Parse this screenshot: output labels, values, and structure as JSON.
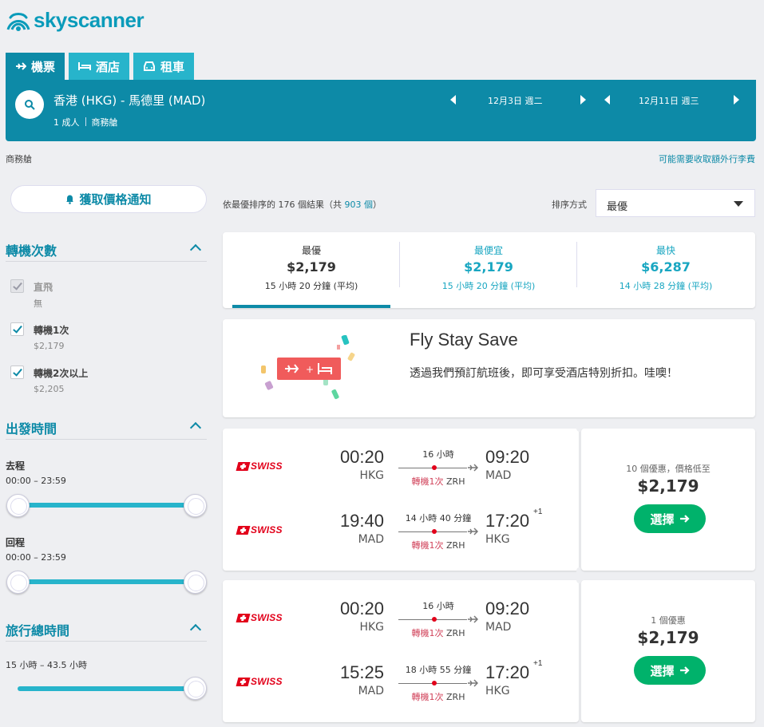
{
  "brand": {
    "name": "skyscanner"
  },
  "tabs": [
    {
      "label": "機票",
      "icon": "plane-icon",
      "active": true
    },
    {
      "label": "酒店",
      "icon": "bed-icon",
      "active": false
    },
    {
      "label": "租車",
      "icon": "car-icon",
      "active": false
    }
  ],
  "search": {
    "route": "香港 (HKG) - 馬德里 (MAD)",
    "passengers": "1 成人",
    "cabin": "商務艙",
    "outbound_date": "12月3日 週二",
    "return_date": "12月11日 週三"
  },
  "subheader": {
    "cabin_label": "商務艙",
    "baggage_link": "可能需要收取額外行李費"
  },
  "sidebar": {
    "price_alert": "獲取價格通知",
    "stops": {
      "title": "轉機次數",
      "options": [
        {
          "label": "直飛",
          "sub": "無",
          "checked": true,
          "disabled": true
        },
        {
          "label": "轉機1次",
          "sub": "$2,179",
          "checked": true,
          "disabled": false
        },
        {
          "label": "轉機2次以上",
          "sub": "$2,205",
          "checked": true,
          "disabled": false
        }
      ]
    },
    "times": {
      "title": "出發時間",
      "outbound_label": "去程",
      "outbound_range": "00:00 – 23:59",
      "return_label": "回程",
      "return_range": "00:00 – 23:59"
    },
    "duration": {
      "title": "旅行總時間",
      "range": "15 小時 – 43.5 小時"
    }
  },
  "results": {
    "count_prefix": "依最優排序的 176 個結果（共 ",
    "total": "903 個",
    "count_suffix": "）",
    "sort_label": "排序方式",
    "sort_value": "最優"
  },
  "sort_tabs": [
    {
      "label": "最優",
      "price": "$2,179",
      "duration": "15 小時 20 分鐘 (平均)",
      "active": true
    },
    {
      "label": "最便宜",
      "price": "$2,179",
      "duration": "15 小時 20 分鐘 (平均)",
      "active": false
    },
    {
      "label": "最快",
      "price": "$6,287",
      "duration": "14 小時 28 分鐘 (平均)",
      "active": false
    }
  ],
  "promo": {
    "title": "Fly Stay Save",
    "text": "透過我們預訂航班後，即可享受酒店特別折扣。哇噢！"
  },
  "itineraries": [
    {
      "legs": [
        {
          "airline": "SWISS",
          "dep_time": "00:20",
          "dep_code": "HKG",
          "duration": "16 小時",
          "stops": "轉機1次",
          "via": "ZRH",
          "arr_time": "09:20",
          "arr_code": "MAD",
          "day_offset": ""
        },
        {
          "airline": "SWISS",
          "dep_time": "19:40",
          "dep_code": "MAD",
          "duration": "14 小時 40 分鐘",
          "stops": "轉機1次",
          "via": "ZRH",
          "arr_time": "17:20",
          "arr_code": "HKG",
          "day_offset": "+1"
        }
      ],
      "deals": "10 個優惠，價格低至",
      "price": "$2,179",
      "button": "選擇"
    },
    {
      "legs": [
        {
          "airline": "SWISS",
          "dep_time": "00:20",
          "dep_code": "HKG",
          "duration": "16 小時",
          "stops": "轉機1次",
          "via": "ZRH",
          "arr_time": "09:20",
          "arr_code": "MAD",
          "day_offset": ""
        },
        {
          "airline": "SWISS",
          "dep_time": "15:25",
          "dep_code": "MAD",
          "duration": "18 小時 55 分鐘",
          "stops": "轉機1次",
          "via": "ZRH",
          "arr_time": "17:20",
          "arr_code": "HKG",
          "day_offset": "+1"
        }
      ],
      "deals": "1 個優惠",
      "price": "$2,179",
      "button": "選擇"
    }
  ],
  "colors": {
    "brand": "#0d8aa7",
    "accent": "#27b4cb",
    "cta": "#00b26b",
    "stop_red": "#d1435b",
    "swiss_red": "#e2001a"
  }
}
